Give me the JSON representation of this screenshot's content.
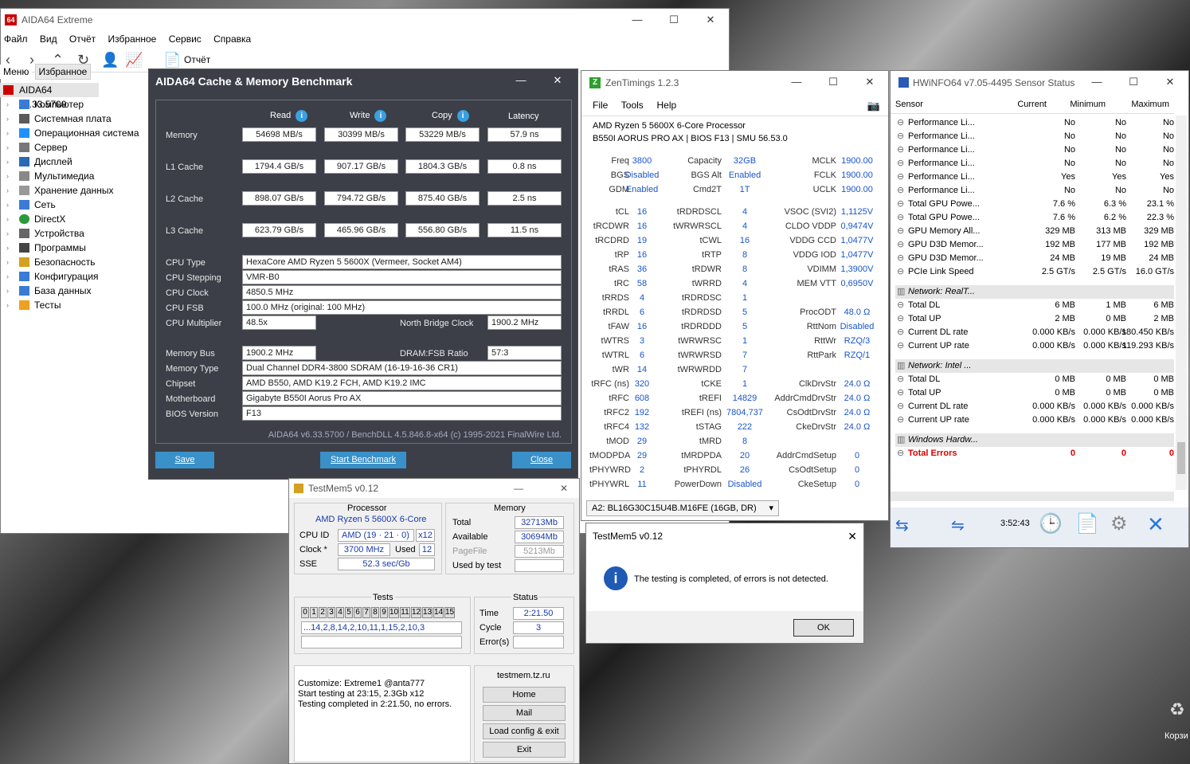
{
  "aida": {
    "title": "AIDA64 Extreme",
    "logo": "64",
    "menu": [
      "Файл",
      "Вид",
      "Отчёт",
      "Избранное",
      "Сервис",
      "Справка"
    ],
    "report_label": "Отчёт",
    "tab_menu": "Меню",
    "tab_fav": "Избранное",
    "root": "AIDA64 v6.33.5700",
    "tree": [
      "Компьютер",
      "Системная плата",
      "Операционная система",
      "Сервер",
      "Дисплей",
      "Мультимедиа",
      "Хранение данных",
      "Сеть",
      "DirectX",
      "Устройства",
      "Программы",
      "Безопасность",
      "Конфигурация",
      "База данных",
      "Тесты"
    ]
  },
  "bench": {
    "title": "AIDA64 Cache & Memory Benchmark",
    "headers": [
      "Read",
      "Write",
      "Copy",
      "Latency"
    ],
    "rows": [
      {
        "label": "Memory",
        "vals": [
          "54698 MB/s",
          "30399 MB/s",
          "53229 MB/s",
          "57.9 ns"
        ]
      },
      {
        "label": "L1 Cache",
        "vals": [
          "1794.4 GB/s",
          "907.17 GB/s",
          "1804.3 GB/s",
          "0.8 ns"
        ]
      },
      {
        "label": "L2 Cache",
        "vals": [
          "898.07 GB/s",
          "794.72 GB/s",
          "875.40 GB/s",
          "2.5 ns"
        ]
      },
      {
        "label": "L3 Cache",
        "vals": [
          "623.79 GB/s",
          "465.96 GB/s",
          "556.80 GB/s",
          "11.5 ns"
        ]
      }
    ],
    "cpu_type_l": "CPU Type",
    "cpu_type": "HexaCore AMD Ryzen 5 5600X  (Vermeer, Socket AM4)",
    "cpu_step_l": "CPU Stepping",
    "cpu_step": "VMR-B0",
    "cpu_clock_l": "CPU Clock",
    "cpu_clock": "4850.5 MHz",
    "cpu_fsb_l": "CPU FSB",
    "cpu_fsb": "100.0 MHz  (original: 100 MHz)",
    "cpu_mult_l": "CPU Multiplier",
    "cpu_mult": "48.5x",
    "nb_l": "North Bridge Clock",
    "nb": "1900.2 MHz",
    "mem_bus_l": "Memory Bus",
    "mem_bus": "1900.2 MHz",
    "dram_l": "DRAM:FSB Ratio",
    "dram": "57:3",
    "mem_type_l": "Memory Type",
    "mem_type": "Dual Channel DDR4-3800 SDRAM  (16-19-16-36 CR1)",
    "chipset_l": "Chipset",
    "chipset": "AMD B550, AMD K19.2 FCH, AMD K19.2 IMC",
    "mobo_l": "Motherboard",
    "mobo": "Gigabyte B550I Aorus Pro AX",
    "bios_l": "BIOS Version",
    "bios": "F13",
    "footer": "AIDA64 v6.33.5700 / BenchDLL 4.5.846.8-x64  (c) 1995-2021 FinalWire Ltd.",
    "save": "Save",
    "start": "Start Benchmark",
    "close": "Close"
  },
  "zen": {
    "title": "ZenTimings 1.2.3",
    "menu": [
      "File",
      "Tools",
      "Help"
    ],
    "cpu": "AMD Ryzen 5 5600X 6-Core Processor",
    "board": "B550I AORUS PRO AX | BIOS F13 | SMU 56.53.0",
    "top": [
      [
        "Freq",
        "3800",
        "Capacity",
        "32GB",
        "MCLK",
        "1900.00"
      ],
      [
        "BGS",
        "Disabled",
        "BGS Alt",
        "Enabled",
        "FCLK",
        "1900.00"
      ],
      [
        "GDM",
        "Enabled",
        "Cmd2T",
        "1T",
        "UCLK",
        "1900.00"
      ]
    ],
    "rows": [
      [
        "tCL",
        "16",
        "tRDRDSCL",
        "4",
        "VSOC (SVI2)",
        "1,1125V"
      ],
      [
        "tRCDWR",
        "16",
        "tWRWRSCL",
        "4",
        "CLDO VDDP",
        "0,9474V"
      ],
      [
        "tRCDRD",
        "19",
        "tCWL",
        "16",
        "VDDG CCD",
        "1,0477V"
      ],
      [
        "tRP",
        "16",
        "tRTP",
        "8",
        "VDDG IOD",
        "1,0477V"
      ],
      [
        "tRAS",
        "36",
        "tRDWR",
        "8",
        "VDIMM",
        "1,3900V"
      ],
      [
        "tRC",
        "58",
        "tWRRD",
        "4",
        "MEM VTT",
        "0,6950V"
      ],
      [
        "tRRDS",
        "4",
        "tRDRDSC",
        "1",
        "",
        ""
      ],
      [
        "tRRDL",
        "6",
        "tRDRDSD",
        "5",
        "ProcODT",
        "48.0 Ω"
      ],
      [
        "tFAW",
        "16",
        "tRDRDDD",
        "5",
        "RttNom",
        "Disabled"
      ],
      [
        "tWTRS",
        "3",
        "tWRWRSC",
        "1",
        "RttWr",
        "RZQ/3"
      ],
      [
        "tWTRL",
        "6",
        "tWRWRSD",
        "7",
        "RttPark",
        "RZQ/1"
      ],
      [
        "tWR",
        "14",
        "tWRWRDD",
        "7",
        "",
        ""
      ],
      [
        "tRFC (ns)",
        "320",
        "tCKE",
        "1",
        "ClkDrvStr",
        "24.0 Ω"
      ],
      [
        "tRFC",
        "608",
        "tREFI",
        "14829",
        "AddrCmdDrvStr",
        "24.0 Ω"
      ],
      [
        "tRFC2",
        "192",
        "tREFI (ns)",
        "7804,737",
        "CsOdtDrvStr",
        "24.0 Ω"
      ],
      [
        "tRFC4",
        "132",
        "tSTAG",
        "222",
        "CkeDrvStr",
        "24.0 Ω"
      ],
      [
        "tMOD",
        "29",
        "tMRD",
        "8",
        "",
        ""
      ],
      [
        "tMODPDA",
        "29",
        "tMRDPDA",
        "20",
        "AddrCmdSetup",
        "0"
      ],
      [
        "tPHYWRD",
        "2",
        "tPHYRDL",
        "26",
        "CsOdtSetup",
        "0"
      ],
      [
        "tPHYWRL",
        "11",
        "PowerDown",
        "Disabled",
        "CkeSetup",
        "0"
      ]
    ],
    "dimm": "A2: BL16G30C15U4B.M16FE (16GB, DR)"
  },
  "hw": {
    "title": "HWiNFO64 v7.05-4495 Sensor Status",
    "cols": [
      "Sensor",
      "Current",
      "Minimum",
      "Maximum"
    ],
    "rows": [
      [
        "Performance Li...",
        "No",
        "No",
        "No"
      ],
      [
        "Performance Li...",
        "No",
        "No",
        "No"
      ],
      [
        "Performance Li...",
        "No",
        "No",
        "No"
      ],
      [
        "Performance Li...",
        "No",
        "No",
        "No"
      ],
      [
        "Performance Li...",
        "Yes",
        "Yes",
        "Yes"
      ],
      [
        "Performance Li...",
        "No",
        "No",
        "No"
      ],
      [
        "Total GPU Powe...",
        "7.6 %",
        "6.3 %",
        "23.1 %"
      ],
      [
        "Total GPU Powe...",
        "7.6 %",
        "6.2 %",
        "22.3 %"
      ],
      [
        "GPU Memory All...",
        "329 MB",
        "313 MB",
        "329 MB"
      ],
      [
        "GPU D3D Memor...",
        "192 MB",
        "177 MB",
        "192 MB"
      ],
      [
        "GPU D3D Memor...",
        "24 MB",
        "19 MB",
        "24 MB"
      ],
      [
        "PCIe Link Speed",
        "2.5 GT/s",
        "2.5 GT/s",
        "16.0 GT/s"
      ],
      [
        "Network: RealT...",
        "",
        "",
        ""
      ],
      [
        "Total DL",
        "6 MB",
        "1 MB",
        "6 MB"
      ],
      [
        "Total UP",
        "2 MB",
        "0 MB",
        "2 MB"
      ],
      [
        "Current DL rate",
        "0.000 KB/s",
        "0.000 KB/s",
        "180.450 KB/s"
      ],
      [
        "Current UP rate",
        "0.000 KB/s",
        "0.000 KB/s",
        "119.293 KB/s"
      ],
      [
        "Network: Intel ...",
        "",
        "",
        ""
      ],
      [
        "Total DL",
        "0 MB",
        "0 MB",
        "0 MB"
      ],
      [
        "Total UP",
        "0 MB",
        "0 MB",
        "0 MB"
      ],
      [
        "Current DL rate",
        "0.000 KB/s",
        "0.000 KB/s",
        "0.000 KB/s"
      ],
      [
        "Current UP rate",
        "0.000 KB/s",
        "0.000 KB/s",
        "0.000 KB/s"
      ],
      [
        "Windows Hardw...",
        "",
        "",
        ""
      ],
      [
        "Total Errors",
        "0",
        "0",
        "0"
      ]
    ],
    "time": "3:52:43"
  },
  "tm": {
    "title": "TestMem5 v0.12",
    "proc_h": "Processor",
    "proc": "AMD Ryzen 5 5600X 6-Core",
    "cpuid_l": "CPU ID",
    "cpuid": "AMD  (19 · 21 · 0)",
    "cpuid_x": "x12",
    "clock_l": "Clock *",
    "clock": "3700 MHz",
    "used_l": "Used",
    "used": "12",
    "sse_l": "SSE",
    "sse": "52.3 sec/Gb",
    "mem_h": "Memory",
    "total_l": "Total",
    "total": "32713Mb",
    "avail_l": "Available",
    "avail": "30694Mb",
    "page_l": "PageFile",
    "page": "5213Mb",
    "ubt_l": "Used by test",
    "tests_h": "Tests",
    "tests": [
      "0",
      "1",
      "2",
      "3",
      "4",
      "5",
      "6",
      "7",
      "8",
      "9",
      "10",
      "11",
      "12",
      "13",
      "14",
      "15"
    ],
    "seq": "...14,2,8,14,2,10,11,1,15,2,10,3",
    "status_h": "Status",
    "time_l": "Time",
    "time": "2:21.50",
    "cycle_l": "Cycle",
    "cycle": "3",
    "err_l": "Error(s)",
    "log": [
      "Customize: Extreme1 @anta777",
      "Start testing at 23:15, 2.3Gb x12",
      "Testing completed in 2:21.50, no errors."
    ],
    "site": "testmem.tz.ru",
    "btns": [
      "Home",
      "Mail",
      "Load config & exit",
      "Exit"
    ]
  },
  "dlg": {
    "title": "TestMem5 v0.12",
    "msg": "The testing is completed, of errors is not detected.",
    "ok": "OK"
  },
  "desktop": {
    "recycle": "Корзи"
  }
}
